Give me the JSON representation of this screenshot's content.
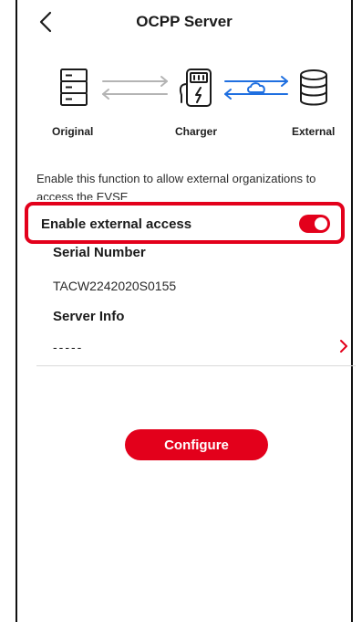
{
  "header": {
    "title": "OCPP Server",
    "back_icon": "chevron-left-icon"
  },
  "diagram": {
    "nodes": [
      {
        "label": "Original",
        "icon": "server-rack-icon"
      },
      {
        "label": "Charger",
        "icon": "ev-charger-icon"
      },
      {
        "label": "External",
        "icon": "database-icon"
      }
    ],
    "links": [
      {
        "from": "Original",
        "to": "Charger",
        "color": "#b4b4b4",
        "icon": "bidirectional-arrows-icon"
      },
      {
        "from": "Charger",
        "to": "External",
        "color": "#1f6fe0",
        "icon": "cloud-sync-icon"
      }
    ]
  },
  "description": "Enable this function to allow external organizations to access the EVSE",
  "external_access": {
    "label": "Enable external access",
    "enabled": true
  },
  "serial": {
    "heading": "Serial Number",
    "value": "TACW2242020S0155"
  },
  "server_info": {
    "heading": "Server Info",
    "value": "-----"
  },
  "actions": {
    "configure_label": "Configure"
  },
  "colors": {
    "accent": "#e3001b",
    "link_active": "#1f6fe0",
    "link_inactive": "#b4b4b4",
    "divider": "#d9d9d9"
  }
}
